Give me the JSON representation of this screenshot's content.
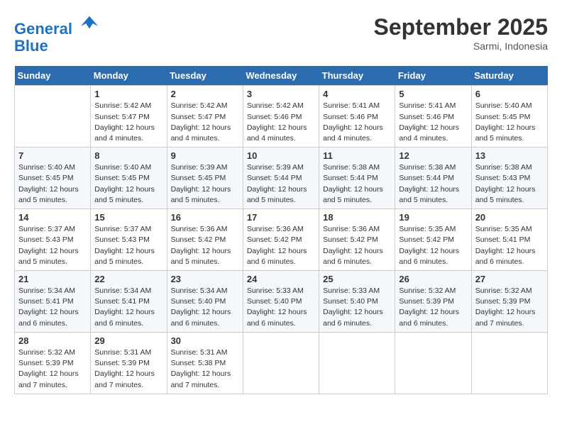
{
  "header": {
    "logo_line1": "General",
    "logo_line2": "Blue",
    "month": "September 2025",
    "location": "Sarmi, Indonesia"
  },
  "days_of_week": [
    "Sunday",
    "Monday",
    "Tuesday",
    "Wednesday",
    "Thursday",
    "Friday",
    "Saturday"
  ],
  "weeks": [
    [
      {
        "day": "",
        "info": ""
      },
      {
        "day": "1",
        "info": "Sunrise: 5:42 AM\nSunset: 5:47 PM\nDaylight: 12 hours\nand 4 minutes."
      },
      {
        "day": "2",
        "info": "Sunrise: 5:42 AM\nSunset: 5:47 PM\nDaylight: 12 hours\nand 4 minutes."
      },
      {
        "day": "3",
        "info": "Sunrise: 5:42 AM\nSunset: 5:46 PM\nDaylight: 12 hours\nand 4 minutes."
      },
      {
        "day": "4",
        "info": "Sunrise: 5:41 AM\nSunset: 5:46 PM\nDaylight: 12 hours\nand 4 minutes."
      },
      {
        "day": "5",
        "info": "Sunrise: 5:41 AM\nSunset: 5:46 PM\nDaylight: 12 hours\nand 4 minutes."
      },
      {
        "day": "6",
        "info": "Sunrise: 5:40 AM\nSunset: 5:45 PM\nDaylight: 12 hours\nand 5 minutes."
      }
    ],
    [
      {
        "day": "7",
        "info": "Sunrise: 5:40 AM\nSunset: 5:45 PM\nDaylight: 12 hours\nand 5 minutes."
      },
      {
        "day": "8",
        "info": "Sunrise: 5:40 AM\nSunset: 5:45 PM\nDaylight: 12 hours\nand 5 minutes."
      },
      {
        "day": "9",
        "info": "Sunrise: 5:39 AM\nSunset: 5:45 PM\nDaylight: 12 hours\nand 5 minutes."
      },
      {
        "day": "10",
        "info": "Sunrise: 5:39 AM\nSunset: 5:44 PM\nDaylight: 12 hours\nand 5 minutes."
      },
      {
        "day": "11",
        "info": "Sunrise: 5:38 AM\nSunset: 5:44 PM\nDaylight: 12 hours\nand 5 minutes."
      },
      {
        "day": "12",
        "info": "Sunrise: 5:38 AM\nSunset: 5:44 PM\nDaylight: 12 hours\nand 5 minutes."
      },
      {
        "day": "13",
        "info": "Sunrise: 5:38 AM\nSunset: 5:43 PM\nDaylight: 12 hours\nand 5 minutes."
      }
    ],
    [
      {
        "day": "14",
        "info": "Sunrise: 5:37 AM\nSunset: 5:43 PM\nDaylight: 12 hours\nand 5 minutes."
      },
      {
        "day": "15",
        "info": "Sunrise: 5:37 AM\nSunset: 5:43 PM\nDaylight: 12 hours\nand 5 minutes."
      },
      {
        "day": "16",
        "info": "Sunrise: 5:36 AM\nSunset: 5:42 PM\nDaylight: 12 hours\nand 5 minutes."
      },
      {
        "day": "17",
        "info": "Sunrise: 5:36 AM\nSunset: 5:42 PM\nDaylight: 12 hours\nand 6 minutes."
      },
      {
        "day": "18",
        "info": "Sunrise: 5:36 AM\nSunset: 5:42 PM\nDaylight: 12 hours\nand 6 minutes."
      },
      {
        "day": "19",
        "info": "Sunrise: 5:35 AM\nSunset: 5:42 PM\nDaylight: 12 hours\nand 6 minutes."
      },
      {
        "day": "20",
        "info": "Sunrise: 5:35 AM\nSunset: 5:41 PM\nDaylight: 12 hours\nand 6 minutes."
      }
    ],
    [
      {
        "day": "21",
        "info": "Sunrise: 5:34 AM\nSunset: 5:41 PM\nDaylight: 12 hours\nand 6 minutes."
      },
      {
        "day": "22",
        "info": "Sunrise: 5:34 AM\nSunset: 5:41 PM\nDaylight: 12 hours\nand 6 minutes."
      },
      {
        "day": "23",
        "info": "Sunrise: 5:34 AM\nSunset: 5:40 PM\nDaylight: 12 hours\nand 6 minutes."
      },
      {
        "day": "24",
        "info": "Sunrise: 5:33 AM\nSunset: 5:40 PM\nDaylight: 12 hours\nand 6 minutes."
      },
      {
        "day": "25",
        "info": "Sunrise: 5:33 AM\nSunset: 5:40 PM\nDaylight: 12 hours\nand 6 minutes."
      },
      {
        "day": "26",
        "info": "Sunrise: 5:32 AM\nSunset: 5:39 PM\nDaylight: 12 hours\nand 6 minutes."
      },
      {
        "day": "27",
        "info": "Sunrise: 5:32 AM\nSunset: 5:39 PM\nDaylight: 12 hours\nand 7 minutes."
      }
    ],
    [
      {
        "day": "28",
        "info": "Sunrise: 5:32 AM\nSunset: 5:39 PM\nDaylight: 12 hours\nand 7 minutes."
      },
      {
        "day": "29",
        "info": "Sunrise: 5:31 AM\nSunset: 5:39 PM\nDaylight: 12 hours\nand 7 minutes."
      },
      {
        "day": "30",
        "info": "Sunrise: 5:31 AM\nSunset: 5:38 PM\nDaylight: 12 hours\nand 7 minutes."
      },
      {
        "day": "",
        "info": ""
      },
      {
        "day": "",
        "info": ""
      },
      {
        "day": "",
        "info": ""
      },
      {
        "day": "",
        "info": ""
      }
    ]
  ]
}
